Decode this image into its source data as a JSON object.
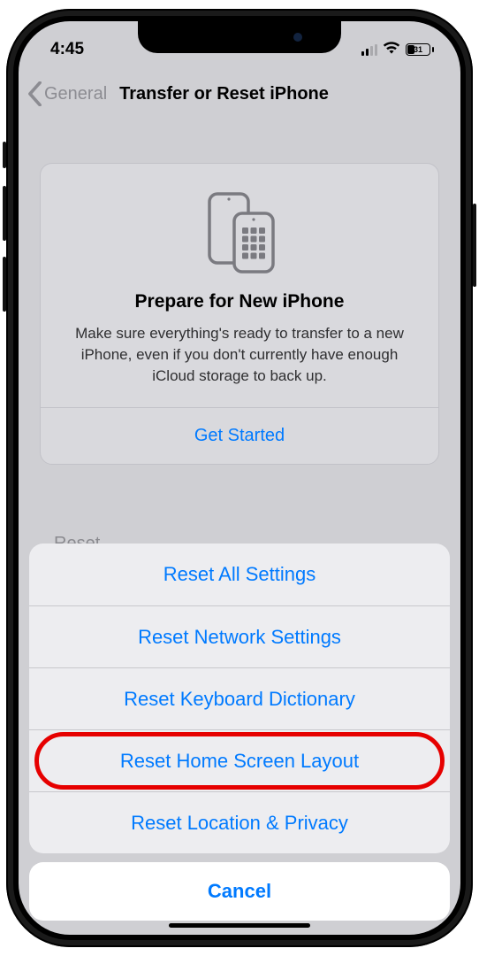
{
  "status": {
    "time": "4:45",
    "battery_percent": "31"
  },
  "nav": {
    "back_label": "General",
    "title": "Transfer or Reset iPhone"
  },
  "card": {
    "title": "Prepare for New iPhone",
    "description": "Make sure everything's ready to transfer to a new iPhone, even if you don't currently have enough iCloud storage to back up.",
    "action": "Get Started"
  },
  "sheet": {
    "partial_label": "Reset",
    "items": [
      "Reset All Settings",
      "Reset Network Settings",
      "Reset Keyboard Dictionary",
      "Reset Home Screen Layout",
      "Reset Location & Privacy"
    ],
    "cancel": "Cancel",
    "highlighted_index": 3
  }
}
